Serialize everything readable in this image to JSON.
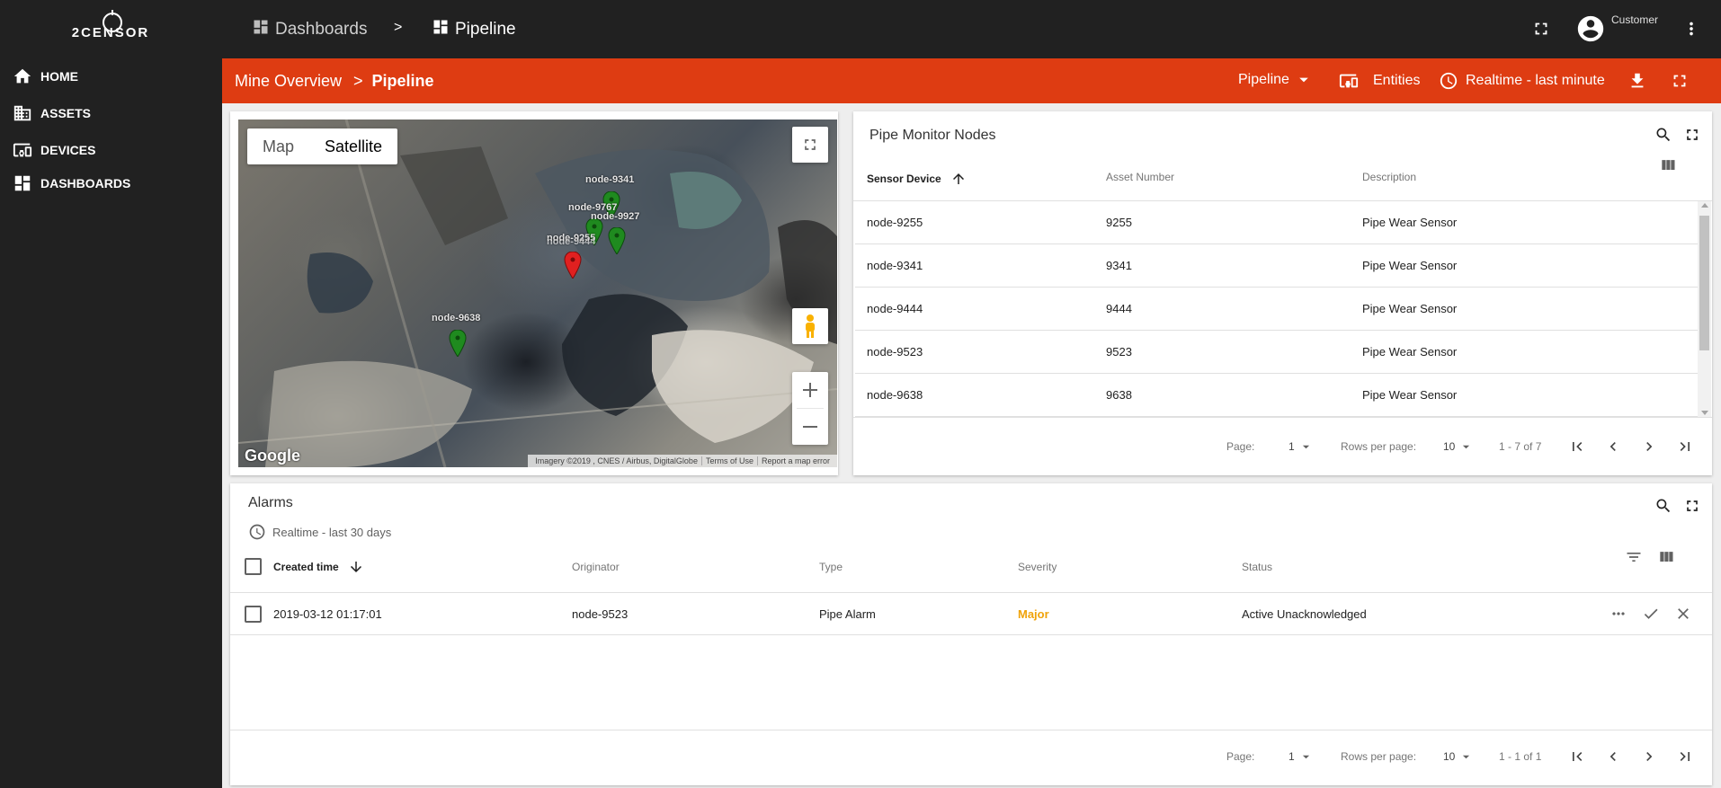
{
  "brand": {
    "logo_text": "2CENSOR"
  },
  "sidebar": {
    "items": [
      {
        "label": "HOME",
        "icon": "home-icon"
      },
      {
        "label": "ASSETS",
        "icon": "assets-icon"
      },
      {
        "label": "DEVICES",
        "icon": "devices-icon"
      },
      {
        "label": "DASHBOARDS",
        "icon": "dashboards-icon"
      }
    ]
  },
  "topbar": {
    "breadcrumb": [
      {
        "label": "Dashboards",
        "icon": "dashboards-icon"
      },
      {
        "label": "Pipeline",
        "icon": "dashboard-icon"
      }
    ],
    "separator": ">",
    "user_label": "Customer"
  },
  "dashbar": {
    "parent": "Mine Overview",
    "separator": ">",
    "current": "Pipeline",
    "state_select": "Pipeline",
    "entities_label": "Entities",
    "timewindow_label": "Realtime - last minute",
    "color": "#de3c12"
  },
  "map": {
    "type_map": "Map",
    "type_satellite": "Satellite",
    "logo": "Google",
    "attribution": [
      "Imagery ©2019 , CNES / Airbus, DigitalGlobe",
      "Terms of Use",
      "Report a map error"
    ],
    "markers": [
      {
        "label": "node-9341",
        "color": "#1f8a1f"
      },
      {
        "label": "node-9767",
        "color": "#1f8a1f"
      },
      {
        "label": "node-9927",
        "color": "#1f8a1f"
      },
      {
        "label": "node-9255",
        "color": "#e02020"
      },
      {
        "label": "node-9638",
        "color": "#1f8a1f"
      }
    ],
    "overlap_label": "node-9444"
  },
  "nodes_table": {
    "title": "Pipe Monitor Nodes",
    "columns": [
      "Sensor Device",
      "Asset Number",
      "Description"
    ],
    "rows": [
      [
        "node-9255",
        "9255",
        "Pipe Wear Sensor"
      ],
      [
        "node-9341",
        "9341",
        "Pipe Wear Sensor"
      ],
      [
        "node-9444",
        "9444",
        "Pipe Wear Sensor"
      ],
      [
        "node-9523",
        "9523",
        "Pipe Wear Sensor"
      ],
      [
        "node-9638",
        "9638",
        "Pipe Wear Sensor"
      ]
    ],
    "pager": {
      "page_label": "Page:",
      "page": "1",
      "rows_label": "Rows per page:",
      "rows": "10",
      "range": "1 - 7 of 7"
    }
  },
  "alarms": {
    "title": "Alarms",
    "timewindow": "Realtime - last 30 days",
    "columns": [
      "Created time",
      "Originator",
      "Type",
      "Severity",
      "Status"
    ],
    "rows": [
      {
        "created": "2019-03-12 01:17:01",
        "originator": "node-9523",
        "type": "Pipe Alarm",
        "severity": "Major",
        "status": "Active Unacknowledged"
      }
    ],
    "severity_color": "#f0a30a",
    "pager": {
      "page_label": "Page:",
      "page": "1",
      "rows_label": "Rows per page:",
      "rows": "10",
      "range": "1 - 1 of 1"
    }
  }
}
